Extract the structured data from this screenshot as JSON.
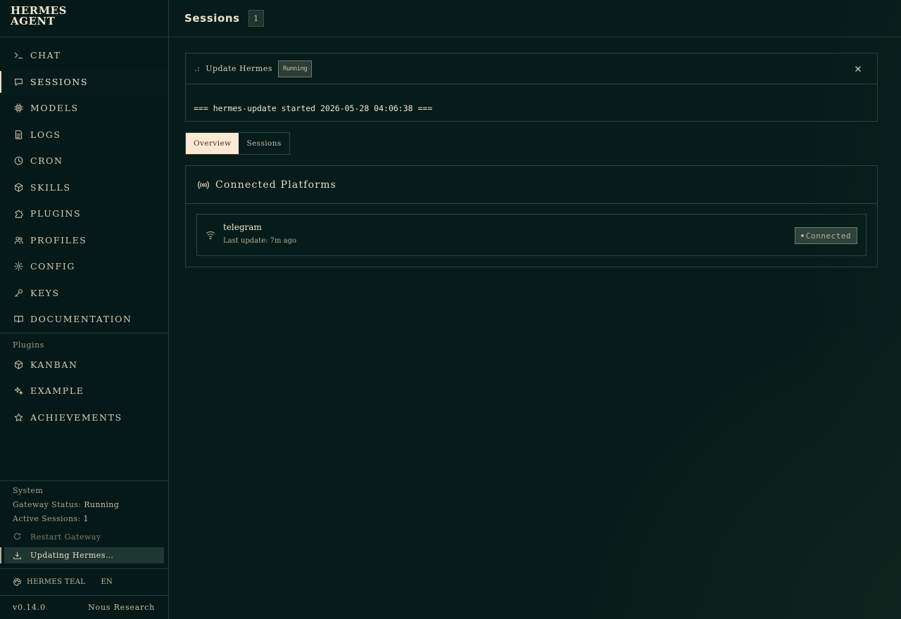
{
  "brand": {
    "line1": "HERMES",
    "line2": "AGENT"
  },
  "sidebar": {
    "nav": [
      {
        "label": "CHAT",
        "icon": "terminal-icon"
      },
      {
        "label": "SESSIONS",
        "icon": "chat-bubble-icon"
      },
      {
        "label": "MODELS",
        "icon": "cpu-icon"
      },
      {
        "label": "LOGS",
        "icon": "file-text-icon"
      },
      {
        "label": "CRON",
        "icon": "clock-icon"
      },
      {
        "label": "SKILLS",
        "icon": "package-icon"
      },
      {
        "label": "PLUGINS",
        "icon": "puzzle-icon"
      },
      {
        "label": "PROFILES",
        "icon": "users-icon"
      },
      {
        "label": "CONFIG",
        "icon": "gear-icon"
      },
      {
        "label": "KEYS",
        "icon": "key-icon"
      },
      {
        "label": "DOCUMENTATION",
        "icon": "book-icon"
      }
    ],
    "active_index": 1,
    "plugins_title": "Plugins",
    "plugins": [
      {
        "label": "KANBAN",
        "icon": "package-icon"
      },
      {
        "label": "EXAMPLE",
        "icon": "sparkles-icon"
      },
      {
        "label": "ACHIEVEMENTS",
        "icon": "star-icon"
      }
    ],
    "system": {
      "title": "System",
      "gateway_label": "Gateway Status:",
      "gateway_value": "Running",
      "sessions_label": "Active Sessions:",
      "sessions_value": "1"
    },
    "restart_label": "Restart Gateway",
    "updating_label": "Updating Hermes…",
    "theme_label": "HERMES TEAL",
    "lang": "EN",
    "version": "v0.14.0",
    "company": "Nous Research"
  },
  "header": {
    "title": "Sessions",
    "count": "1"
  },
  "update": {
    "dots": ".:",
    "title": "Update Hermes",
    "status": "Running",
    "log": "=== hermes-update started 2026-05-28 04:06:38 ==="
  },
  "tabs": [
    {
      "label": "Overview"
    },
    {
      "label": "Sessions"
    }
  ],
  "platforms": {
    "title": "Connected Platforms",
    "items": [
      {
        "name": "telegram",
        "sub": "Last update: 7m ago",
        "status": "Connected"
      }
    ]
  }
}
